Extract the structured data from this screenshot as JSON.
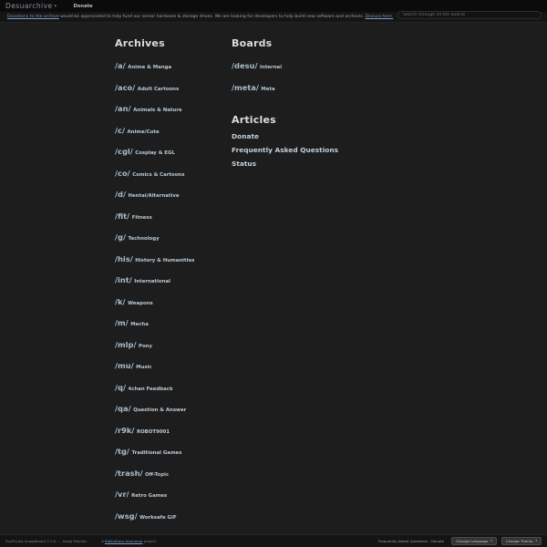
{
  "navbar": {
    "brand": "Desuarchive",
    "brand_caret": "▾",
    "donate_label": "Donate",
    "search_placeholder": "Search through all the boards",
    "search_value": ""
  },
  "banner": {
    "link_text": "Donations to the archive",
    "body_text": " would be appreciated to help fund our server hardware & storage drives. We are looking for developers to help build new software and archives. ",
    "discuss_link": "Discuss here."
  },
  "archives": {
    "title": "Archives",
    "items": [
      {
        "tag": "/a/",
        "desc": "Anime & Manga"
      },
      {
        "tag": "/aco/",
        "desc": "Adult Cartoons"
      },
      {
        "tag": "/an/",
        "desc": "Animals & Nature"
      },
      {
        "tag": "/c/",
        "desc": "Anime/Cute"
      },
      {
        "tag": "/cgl/",
        "desc": "Cosplay & EGL"
      },
      {
        "tag": "/co/",
        "desc": "Comics & Cartoons"
      },
      {
        "tag": "/d/",
        "desc": "Hentai/Alternative"
      },
      {
        "tag": "/fit/",
        "desc": "Fitness"
      },
      {
        "tag": "/g/",
        "desc": "Technology"
      },
      {
        "tag": "/his/",
        "desc": "History & Humanities"
      },
      {
        "tag": "/int/",
        "desc": "International"
      },
      {
        "tag": "/k/",
        "desc": "Weapons"
      },
      {
        "tag": "/m/",
        "desc": "Mecha"
      },
      {
        "tag": "/mlp/",
        "desc": "Pony"
      },
      {
        "tag": "/mu/",
        "desc": "Music"
      },
      {
        "tag": "/q/",
        "desc": "4chan Feedback"
      },
      {
        "tag": "/qa/",
        "desc": "Question & Answer"
      },
      {
        "tag": "/r9k/",
        "desc": "ROBOT9001"
      },
      {
        "tag": "/tg/",
        "desc": "Traditional Games"
      },
      {
        "tag": "/trash/",
        "desc": "Off-Topic"
      },
      {
        "tag": "/vr/",
        "desc": "Retro Games"
      },
      {
        "tag": "/wsg/",
        "desc": "Worksafe GIF"
      }
    ]
  },
  "boards": {
    "title": "Boards",
    "items": [
      {
        "tag": "/desu/",
        "desc": "Internal"
      },
      {
        "tag": "/meta/",
        "desc": "Meta"
      }
    ]
  },
  "articles": {
    "title": "Articles",
    "items": [
      {
        "label": "Donate"
      },
      {
        "label": "Frequently Asked Questions"
      },
      {
        "label": "Status"
      }
    ]
  },
  "footer": {
    "software": "FoolFuuka Imageboard 2.2.0",
    "separator": "-",
    "fetcher": "Asagi Fetcher",
    "project_prefix": "A ",
    "project_link": "Bibliotheca Anonoma",
    "project_suffix": " project",
    "links": "Frequently Asked Questions - Donate",
    "language_button": "Change Language",
    "theme_button": "Change Theme",
    "button_caret": "▾"
  }
}
